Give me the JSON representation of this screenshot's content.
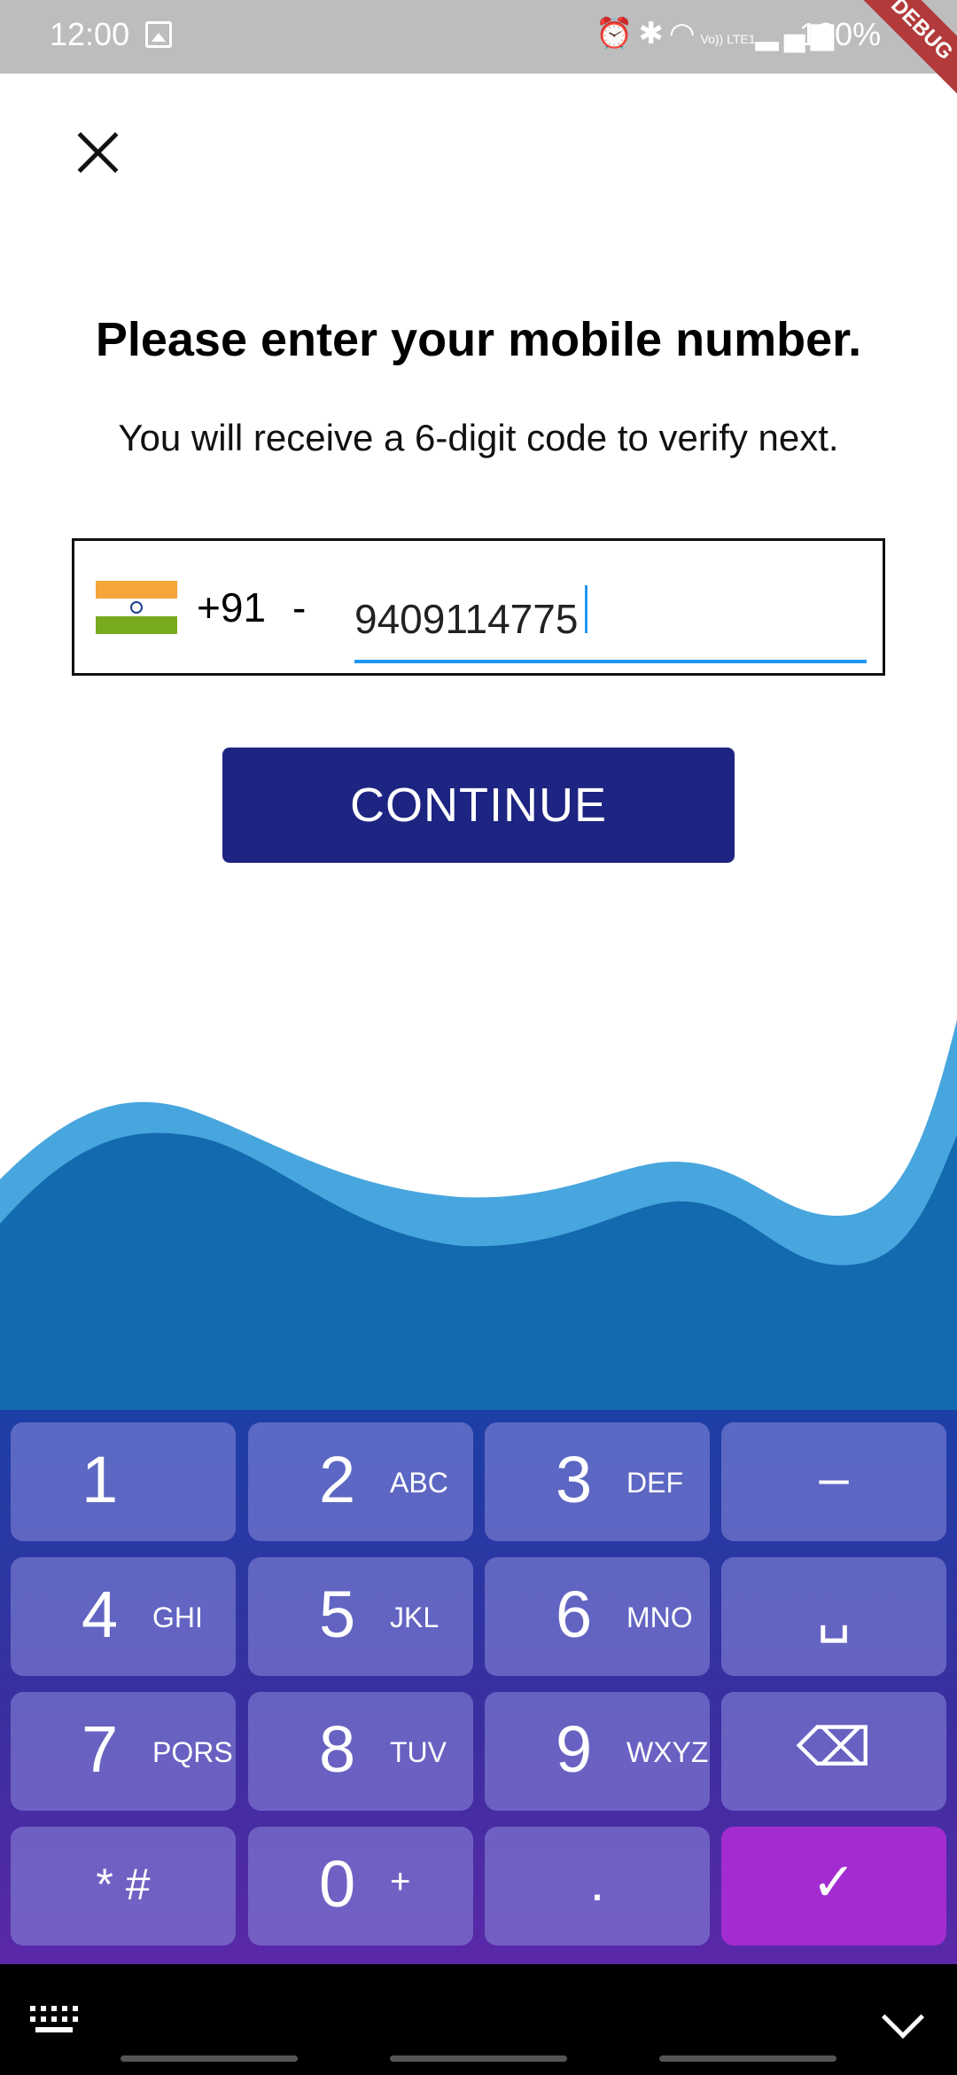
{
  "status_bar": {
    "time": "12:00",
    "battery": "100%",
    "signal_label": "Vo)) LTE1",
    "debug_banner": "DEBUG"
  },
  "screen": {
    "title": "Please enter your mobile number.",
    "subtitle": "You will receive a 6-digit code to verify next.",
    "phone": {
      "country_code": "+91",
      "separator": "-",
      "number": "9409114775"
    },
    "continue_label": "CONTINUE"
  },
  "colors": {
    "primary": "#1d2482",
    "wave_light": "#48a6de",
    "wave_dark": "#136aae",
    "input_underline": "#2196f3",
    "done_key": "#a22ccf"
  },
  "keyboard": {
    "row1": [
      {
        "num": "1",
        "letters": ""
      },
      {
        "num": "2",
        "letters": "ABC"
      },
      {
        "num": "3",
        "letters": "DEF"
      },
      {
        "sym": "–"
      }
    ],
    "row2": [
      {
        "num": "4",
        "letters": "GHI"
      },
      {
        "num": "5",
        "letters": "JKL"
      },
      {
        "num": "6",
        "letters": "MNO"
      },
      {
        "sym": "␣"
      }
    ],
    "row3": [
      {
        "num": "7",
        "letters": "PQRS"
      },
      {
        "num": "8",
        "letters": "TUV"
      },
      {
        "num": "9",
        "letters": "WXYZ"
      },
      {
        "sym": "⌫"
      }
    ],
    "row4": [
      {
        "sym": "* #"
      },
      {
        "num": "0",
        "letters": "+"
      },
      {
        "sym": "."
      },
      {
        "sym": "✓"
      }
    ]
  }
}
